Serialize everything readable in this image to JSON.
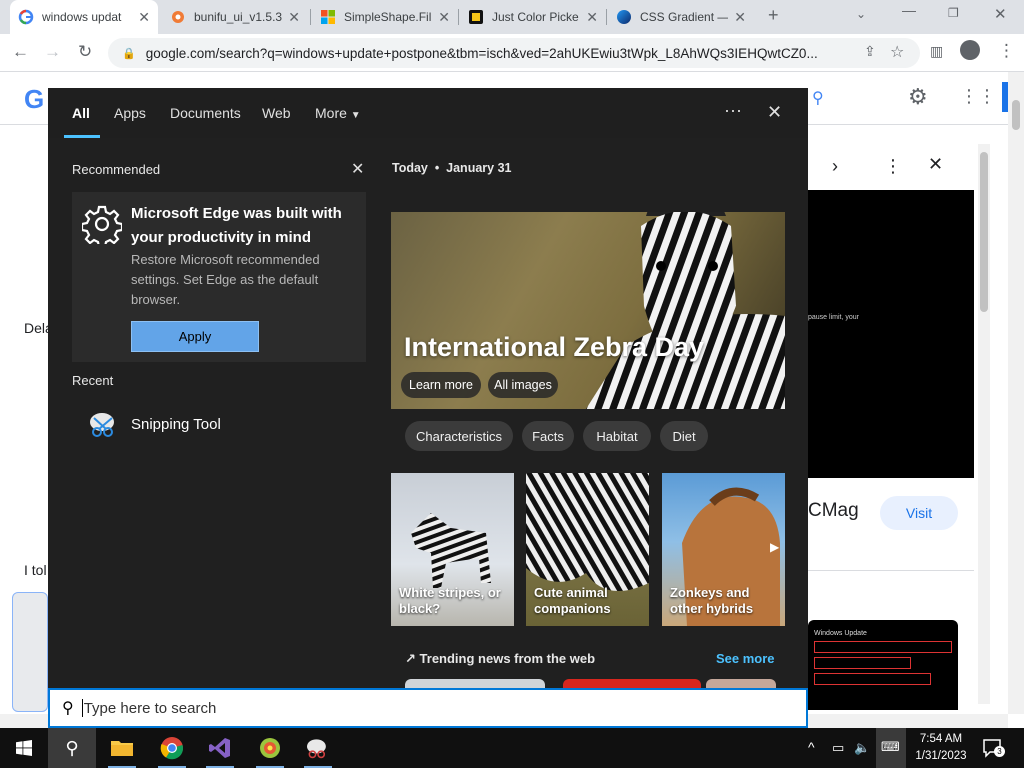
{
  "browser": {
    "tabs": [
      {
        "title": "windows updat",
        "favicon": "google-g-icon"
      },
      {
        "title": "bunifu_ui_v1.5.3",
        "favicon": "bunifu-icon"
      },
      {
        "title": "SimpleShape.Fil",
        "favicon": "microsoft-icon"
      },
      {
        "title": "Just Color Picke",
        "favicon": "color-picker-icon"
      },
      {
        "title": "CSS Gradient —",
        "favicon": "css-gradient-icon"
      }
    ],
    "url": "google.com/search?q=windows+update+postpone&tbm=isch&ved=2ahUKEwiu3tWpk_L8AhWQs3IEHQwtCZ0..."
  },
  "page_behind": {
    "left_texts": [
      "Dela",
      "I tol"
    ],
    "cmag": "CMag",
    "visit": "Visit",
    "dark_text": "pause limit, your",
    "wu_title": "Windows Update"
  },
  "flyout": {
    "tabs": [
      "All",
      "Apps",
      "Documents",
      "Web",
      "More"
    ],
    "recommended_title": "Recommended",
    "card": {
      "heading": "Microsoft Edge was built with your productivity in mind",
      "body": "Restore Microsoft recommended settings. Set Edge as the default browser.",
      "button": "Apply"
    },
    "recent_title": "Recent",
    "recent_items": [
      "Snipping Tool"
    ],
    "today": "Today  •  January 31",
    "hero": {
      "title": "International Zebra Day",
      "learn_more": "Learn more",
      "all_images": "All images"
    },
    "chips": [
      "Characteristics",
      "Facts",
      "Habitat",
      "Diet"
    ],
    "cards": [
      "White stripes, or black?",
      "Cute animal companions",
      "Zonkeys and other hybrids"
    ],
    "trending": "Trending news from the web",
    "see_more": "See more"
  },
  "search": {
    "placeholder": "Type here to search"
  },
  "taskbar": {
    "time": "7:54 AM",
    "date": "1/31/2023",
    "notification_count": "3"
  },
  "colors": {
    "accent": "#0078d7",
    "link": "#4cc2ff",
    "apply_button": "#62a4e8"
  }
}
